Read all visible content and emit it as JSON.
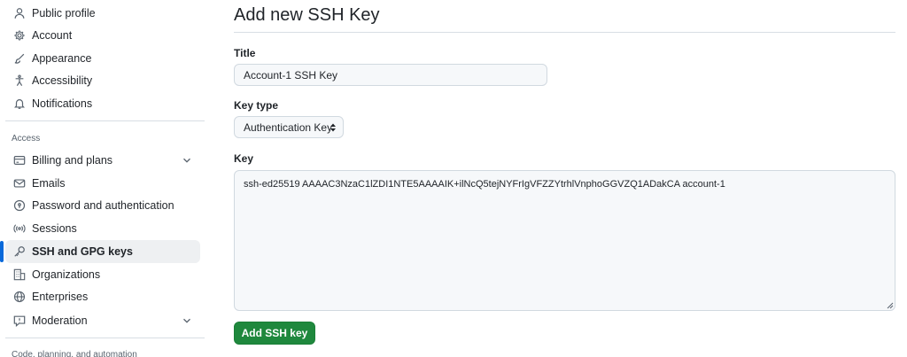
{
  "sidebar": {
    "items": [
      {
        "label": "Public profile",
        "icon": "person-icon"
      },
      {
        "label": "Account",
        "icon": "gear-icon"
      },
      {
        "label": "Appearance",
        "icon": "paintbrush-icon"
      },
      {
        "label": "Accessibility",
        "icon": "accessibility-icon"
      },
      {
        "label": "Notifications",
        "icon": "bell-icon"
      }
    ],
    "access_label": "Access",
    "access_items": [
      {
        "label": "Billing and plans",
        "icon": "credit-card-icon",
        "expandable": true
      },
      {
        "label": "Emails",
        "icon": "mail-icon"
      },
      {
        "label": "Password and authentication",
        "icon": "shield-lock-icon"
      },
      {
        "label": "Sessions",
        "icon": "broadcast-icon"
      },
      {
        "label": "SSH and GPG keys",
        "icon": "key-icon",
        "active": true
      },
      {
        "label": "Organizations",
        "icon": "organization-icon"
      },
      {
        "label": "Enterprises",
        "icon": "globe-icon"
      },
      {
        "label": "Moderation",
        "icon": "report-icon",
        "expandable": true
      }
    ],
    "code_section_label": "Code, planning, and automation"
  },
  "main": {
    "title": "Add new SSH Key",
    "title_field": {
      "label": "Title",
      "value": "Account-1 SSH Key"
    },
    "key_type": {
      "label": "Key type",
      "selected": "Authentication Key"
    },
    "key_field": {
      "label": "Key",
      "value": "ssh-ed25519 AAAAC3NzaC1lZDI1NTE5AAAAIK+ilNcQ5tejNYFrIgVFZZYtrhlVnphoGGVZQ1ADakCA account-1"
    },
    "submit_label": "Add SSH key"
  },
  "colors": {
    "accent": "#0969da",
    "primary_button": "#1f883d",
    "active_bg": "#eef0f2",
    "border": "#d1d9e0"
  }
}
